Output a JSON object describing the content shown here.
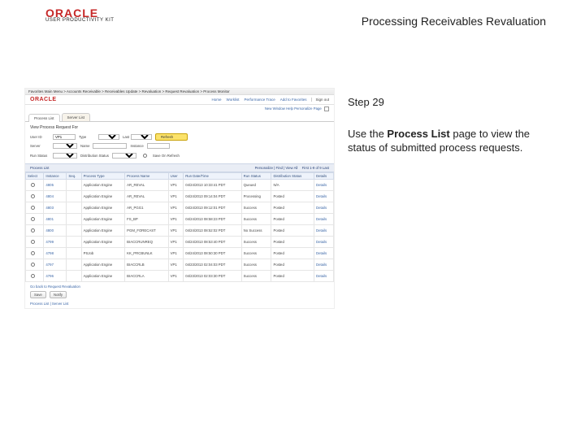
{
  "branding": {
    "logo_text": "ORACLE",
    "logo_sub": "USER PRODUCTIVITY KIT"
  },
  "page_title": "Processing Receivables Revaluation",
  "instruction": {
    "step_label": "Step 29",
    "text_before_bold": "Use the ",
    "bold": "Process List",
    "text_after_bold": " page to view the status of submitted process requests."
  },
  "screenshot": {
    "breadcrumb_left": "Favorites    Main Menu  >  Accounts Receivable  >  Receivables Update  >  Revaluation  >  Request Revaluation  >  Process Monitor",
    "breadcrumb_right": "",
    "brand": "ORACLE",
    "toolbar": [
      "Home",
      "Worklist",
      "Performance Trace",
      "Add to Favorites"
    ],
    "sign_out": "Sign out",
    "new_window_text": "New Window  Help  Personalize Page",
    "tabs": [
      {
        "label": "Process List",
        "active": true
      },
      {
        "label": "Server List",
        "active": false
      }
    ],
    "section_title": "View Process Request For",
    "filters": {
      "user_label": "User ID",
      "user_value": "VP1",
      "type_label": "Type",
      "type_value": "",
      "last_label": "Last",
      "last_value": "",
      "days_options": [
        "Days"
      ],
      "refresh_label": "Refresh",
      "server_label": "Server",
      "server_value": "",
      "name_label": "Name",
      "name_value": "",
      "instance_label": "Instance",
      "instance_value": "",
      "save_label": "Save On Refresh",
      "runstatus_label": "Run Status",
      "diststatus_label": "Distribution Status"
    },
    "list_header": "Process List",
    "list_tools": {
      "personalize": "Personalize | Find | View All",
      "range": "First  1-9 of 9  Last"
    },
    "columns": [
      "Select",
      "Instance",
      "Seq.",
      "Process Type",
      "Process Name",
      "User",
      "Run Date/Time",
      "Run Status",
      "Distribution Status",
      "Details"
    ],
    "rows": [
      {
        "sel": false,
        "instance": "4805",
        "seq": "",
        "ptype": "Application Engine",
        "pname": "AR_REVAL",
        "user": "VP1",
        "run": "04/24/2013 10:33:41 PDT",
        "rstat": "Queued",
        "dstat": "N/A",
        "details": "Details"
      },
      {
        "sel": false,
        "instance": "4804",
        "seq": "",
        "ptype": "Application Engine",
        "pname": "AR_REVAL",
        "user": "VP1",
        "run": "04/24/2013 09:14:04 PDT",
        "rstat": "Processing",
        "dstat": "Posted",
        "details": "Details"
      },
      {
        "sel": false,
        "instance": "4803",
        "seq": "",
        "ptype": "Application Engine",
        "pname": "AR_PGG1",
        "user": "VP1",
        "run": "04/24/2013 09:12:01 PDT",
        "rstat": "Success",
        "dstat": "Posted",
        "details": "Details"
      },
      {
        "sel": false,
        "instance": "4801",
        "seq": "",
        "ptype": "Application Engine",
        "pname": "FS_BP",
        "user": "VP1",
        "run": "04/24/2013 08:58:23 PDT",
        "rstat": "Success",
        "dstat": "Posted",
        "details": "Details"
      },
      {
        "sel": false,
        "instance": "4800",
        "seq": "",
        "ptype": "Application Engine",
        "pname": "PGM_FORECAST",
        "user": "VP1",
        "run": "04/24/2013 08:52:02 PDT",
        "rstat": "No Success",
        "dstat": "Posted",
        "details": "Details"
      },
      {
        "sel": false,
        "instance": "4799",
        "seq": "",
        "ptype": "Application Engine",
        "pname": "BIACCRUNREQ",
        "user": "VP1",
        "run": "04/24/2013 08:53:40 PDT",
        "rstat": "Success",
        "dstat": "Posted",
        "details": "Details"
      },
      {
        "sel": false,
        "instance": "4798",
        "seq": "",
        "ptype": "PSJob",
        "pname": "KK_PRCBUNLK",
        "user": "VP1",
        "run": "04/24/2013 08:50:30 PDT",
        "rstat": "Success",
        "dstat": "Posted",
        "details": "Details"
      },
      {
        "sel": false,
        "instance": "4797",
        "seq": "",
        "ptype": "Application Engine",
        "pname": "BIACCRLB",
        "user": "VP1",
        "run": "04/23/2013 02:04:03 PDT",
        "rstat": "Success",
        "dstat": "Posted",
        "details": "Details"
      },
      {
        "sel": false,
        "instance": "4796",
        "seq": "",
        "ptype": "Application Engine",
        "pname": "BIACCRLA",
        "user": "VP1",
        "run": "04/23/2013 02:03:30 PDT",
        "rstat": "Success",
        "dstat": "Posted",
        "details": "Details"
      }
    ],
    "go_back": "Go back to Request Revaluation",
    "btn_save": "Save",
    "btn_notify": "Notify",
    "footer_links": "Process List | Server List"
  }
}
